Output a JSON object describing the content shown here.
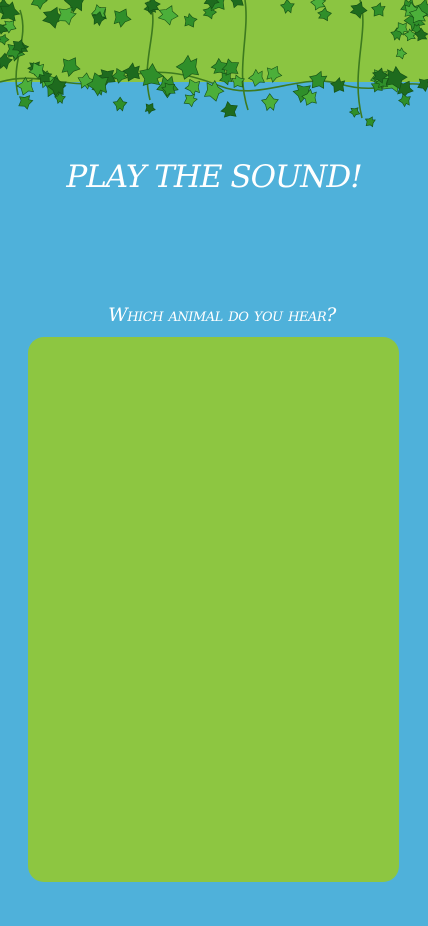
{
  "header": {
    "decoration": "ivy-vines",
    "colors": {
      "banner": "#8bc541",
      "leaf_dark": "#1e6b1e",
      "leaf_mid": "#2f8f2a",
      "leaf_light": "#4caf3a"
    }
  },
  "title": "PLAY THE SOUND!",
  "question": "Which animal do you hear?",
  "colors": {
    "background": "#4fb1da",
    "panel": "#8dc641",
    "text": "#ffffff"
  }
}
